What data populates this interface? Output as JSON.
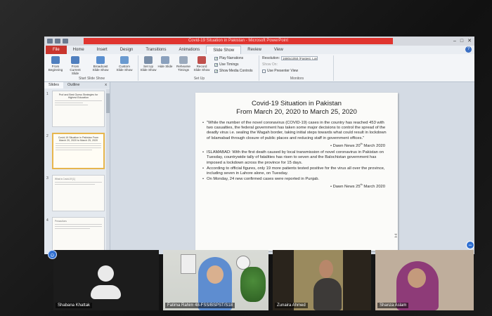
{
  "window": {
    "title": "Covid-19 Situation in Pakistan - Microsoft PowerPoint",
    "controls": [
      "–",
      "□",
      "✕"
    ]
  },
  "ribbon_tabs": [
    {
      "label": "File"
    },
    {
      "label": "Home"
    },
    {
      "label": "Insert"
    },
    {
      "label": "Design"
    },
    {
      "label": "Transitions"
    },
    {
      "label": "Animations"
    },
    {
      "label": "Slide Show"
    },
    {
      "label": "Review"
    },
    {
      "label": "View"
    }
  ],
  "ribbon": {
    "start_group": "Start Slide Show",
    "setup_group": "Set Up",
    "monitors_group": "Monitors",
    "buttons": [
      {
        "label": "From Beginning",
        "color": "#4f7fbf"
      },
      {
        "label": "From Current Slide",
        "color": "#4f7fbf"
      },
      {
        "label": "Broadcast Slide Show",
        "color": "#5a8fcf"
      },
      {
        "label": "Custom Slide Show",
        "color": "#6a9ad0"
      },
      {
        "label": "Set Up Slide Show",
        "color": "#7b8fa8"
      },
      {
        "label": "Hide Slide",
        "color": "#8aa0bd"
      },
      {
        "label": "Rehearse Timings",
        "color": "#9aa9bc"
      },
      {
        "label": "Record Slide Show",
        "color": "#c0504d"
      }
    ],
    "checks": [
      {
        "label": "Play Narrations",
        "on": true
      },
      {
        "label": "Use Timings",
        "on": true
      },
      {
        "label": "Show Media Controls",
        "on": true
      }
    ],
    "resolution_label": "Resolution:",
    "resolution_value": "1680x1050 (Fastest, Lowe...",
    "show_on_label": "Show On:",
    "presenter_view_label": "Use Presenter View"
  },
  "panel": {
    "tabs": [
      "Slides",
      "Outline"
    ],
    "close": "x",
    "thumbs": [
      {
        "num": "1",
        "title": "Prof and Best Guess Strategies for Highest Education",
        "selected": false
      },
      {
        "num": "2",
        "title": "Covid-19 Situation in Pakistan From March 20, 2020 to March 25, 2020",
        "selected": true
      },
      {
        "num": "3",
        "title": "What is Covid-19 [1]",
        "selected": false
      },
      {
        "num": "4",
        "title": "Precautions",
        "selected": false
      }
    ]
  },
  "slide": {
    "title_line1": "Covid-19 Situation in Pakistan",
    "title_line2": "From March 20, 2020 to March 25, 2020",
    "bullet1": "\"While the number of the novel coronavirus (COVID-19) cases in the country has reached 453 with two casualties, the federal government has taken some major decisions to control the spread of the deadly virus i.e. sealing the Wagah border, taking initial steps towards what could result in lockdown of Islamabad through closure of public places and reducing staff in government offices.\"",
    "source1_text": "• Dawn News 20",
    "source1_sup": "th",
    "source1_tail": " March 2020",
    "bullet2": "ISLAMABAD: With the first death caused by local transmission of novel coronavirus in Pakistan on Tuesday, countrywide tally of fatalities has risen to seven and the Balochistan government has imposed a lockdown across the province for 15 days.",
    "bullet3": "According to official figures, only 19 more patients tested positive for the virus all over the province, including seven in Lahore alone, on Tuesday.",
    "bullet4": "On Monday, 24 new confirmed cases were reported in Punjab.",
    "source2_text": "• Dawn News 25",
    "source2_sup": "th",
    "source2_tail": " March 2020"
  },
  "participants": [
    {
      "name": "Shabana Khattak",
      "video": false
    },
    {
      "name": "Fatima Rahim 48-FSS/BSPST/S18",
      "video": true
    },
    {
      "name": "Zunaira Ahmed",
      "video": true
    },
    {
      "name": "Shanza Aslam",
      "video": true
    }
  ],
  "icons": {
    "badge": "person-icon",
    "minus": "minimize-icon"
  }
}
